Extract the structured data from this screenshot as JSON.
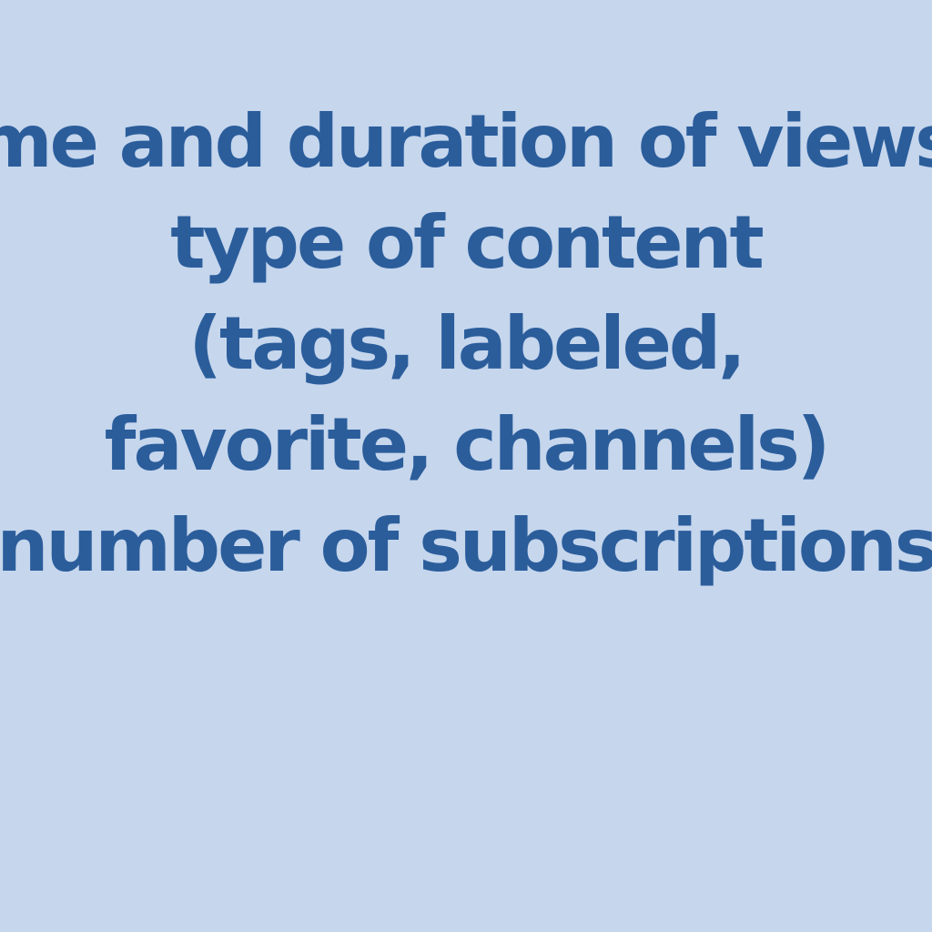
{
  "lines": [
    "me and duration of views",
    "type of content",
    "(tags, labeled,",
    "favorite, channels)",
    "number of subscriptions"
  ],
  "colors": {
    "background": "#c5d6ed",
    "text": "#2b5d9b"
  }
}
